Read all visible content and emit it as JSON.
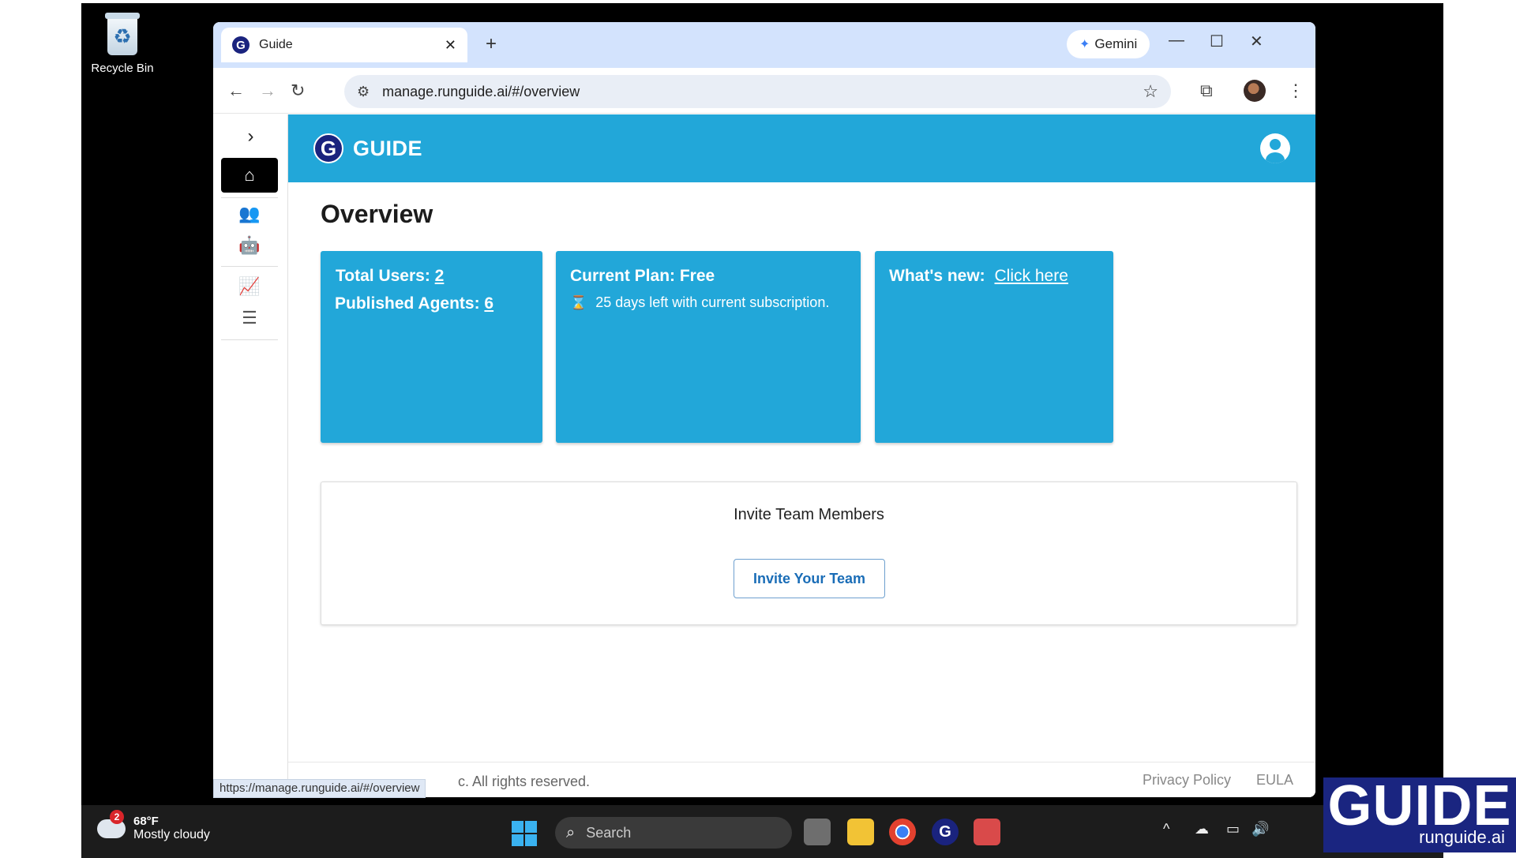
{
  "desktop": {
    "recycle_bin_label": "Recycle Bin"
  },
  "browser": {
    "tab_title": "Guide",
    "new_tab": "+",
    "gemini_label": "Gemini",
    "url": "manage.runguide.ai/#/overview",
    "status_url": "https://manage.runguide.ai/#/overview"
  },
  "app": {
    "brand": "GUIDE",
    "brand_letter": "G",
    "page_title": "Overview",
    "cards": {
      "users_label": "Total Users:",
      "users_value": "2",
      "agents_label": "Published Agents:",
      "agents_value": "6",
      "plan_label": "Current Plan: Free",
      "plan_sub": "25 days left with current subscription.",
      "news_label": "What's new:",
      "news_link": "Click here"
    },
    "invite": {
      "title": "Invite Team Members",
      "button": "Invite Your Team"
    },
    "footer": {
      "copyright": "c. All rights reserved.",
      "privacy": "Privacy Policy",
      "eula": "EULA"
    },
    "colors": {
      "accent": "#22a7d9",
      "brand_dark": "#1a237e"
    }
  },
  "taskbar": {
    "weather_badge": "2",
    "temperature": "68°F",
    "condition": "Mostly cloudy",
    "search_placeholder": "Search"
  },
  "watermark": {
    "big": "GUIDE",
    "small": "runguide.ai"
  },
  "icons": [
    "recycle-bin-icon",
    "guide-favicon",
    "close-icon",
    "new-tab-icon",
    "gemini-star-icon",
    "minimize-icon",
    "maximize-icon",
    "window-close-icon",
    "back-icon",
    "forward-icon",
    "reload-icon",
    "site-settings-icon",
    "bookmark-star-icon",
    "tab-search-icon",
    "profile-avatar",
    "menu-dots-icon",
    "chevron-right-icon",
    "home-icon",
    "users-icon",
    "robot-icon",
    "analytics-icon",
    "list-icon",
    "user-account-icon",
    "hourglass-icon",
    "windows-start-icon",
    "search-icon"
  ]
}
